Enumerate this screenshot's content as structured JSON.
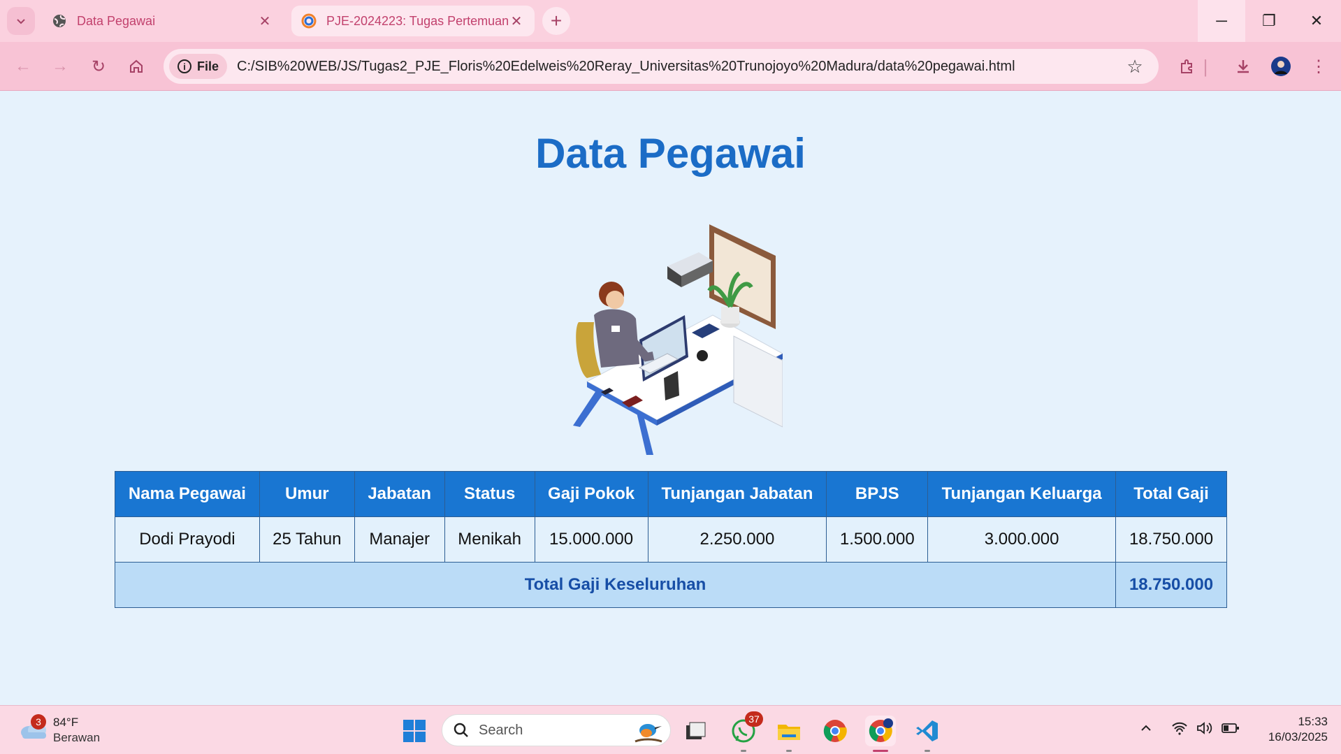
{
  "browser": {
    "tabs": [
      {
        "title": "Data Pegawai"
      },
      {
        "title": "PJE-2024223: Tugas Pertemuan"
      }
    ],
    "address": {
      "scheme_label": "File",
      "url": "C:/SIB%20WEB/JS/Tugas2_PJE_Floris%20Edelweis%20Reray_Universitas%20Trunojoyo%20Madura/data%20pegawai.html"
    }
  },
  "page": {
    "title": "Data Pegawai",
    "table": {
      "headers": [
        "Nama Pegawai",
        "Umur",
        "Jabatan",
        "Status",
        "Gaji Pokok",
        "Tunjangan Jabatan",
        "BPJS",
        "Tunjangan Keluarga",
        "Total Gaji"
      ],
      "rows": [
        [
          "Dodi Prayodi",
          "25 Tahun",
          "Manajer",
          "Menikah",
          "15.000.000",
          "2.250.000",
          "1.500.000",
          "3.000.000",
          "18.750.000"
        ]
      ],
      "total_label": "Total Gaji Keseluruhan",
      "total_value": "18.750.000"
    }
  },
  "taskbar": {
    "weather": {
      "temp": "84°F",
      "condition": "Berawan",
      "badge": "3"
    },
    "search_placeholder": "Search",
    "whatsapp_badge": "37",
    "time": "15:33",
    "date": "16/03/2025"
  },
  "colors": {
    "tab_strip": "#fbd1df",
    "toolbar": "#f8c3d5",
    "page_bg": "#e6f2fc",
    "title": "#1b6cc6",
    "table_header": "#1976d2",
    "total_row": "#bbdcf7"
  }
}
